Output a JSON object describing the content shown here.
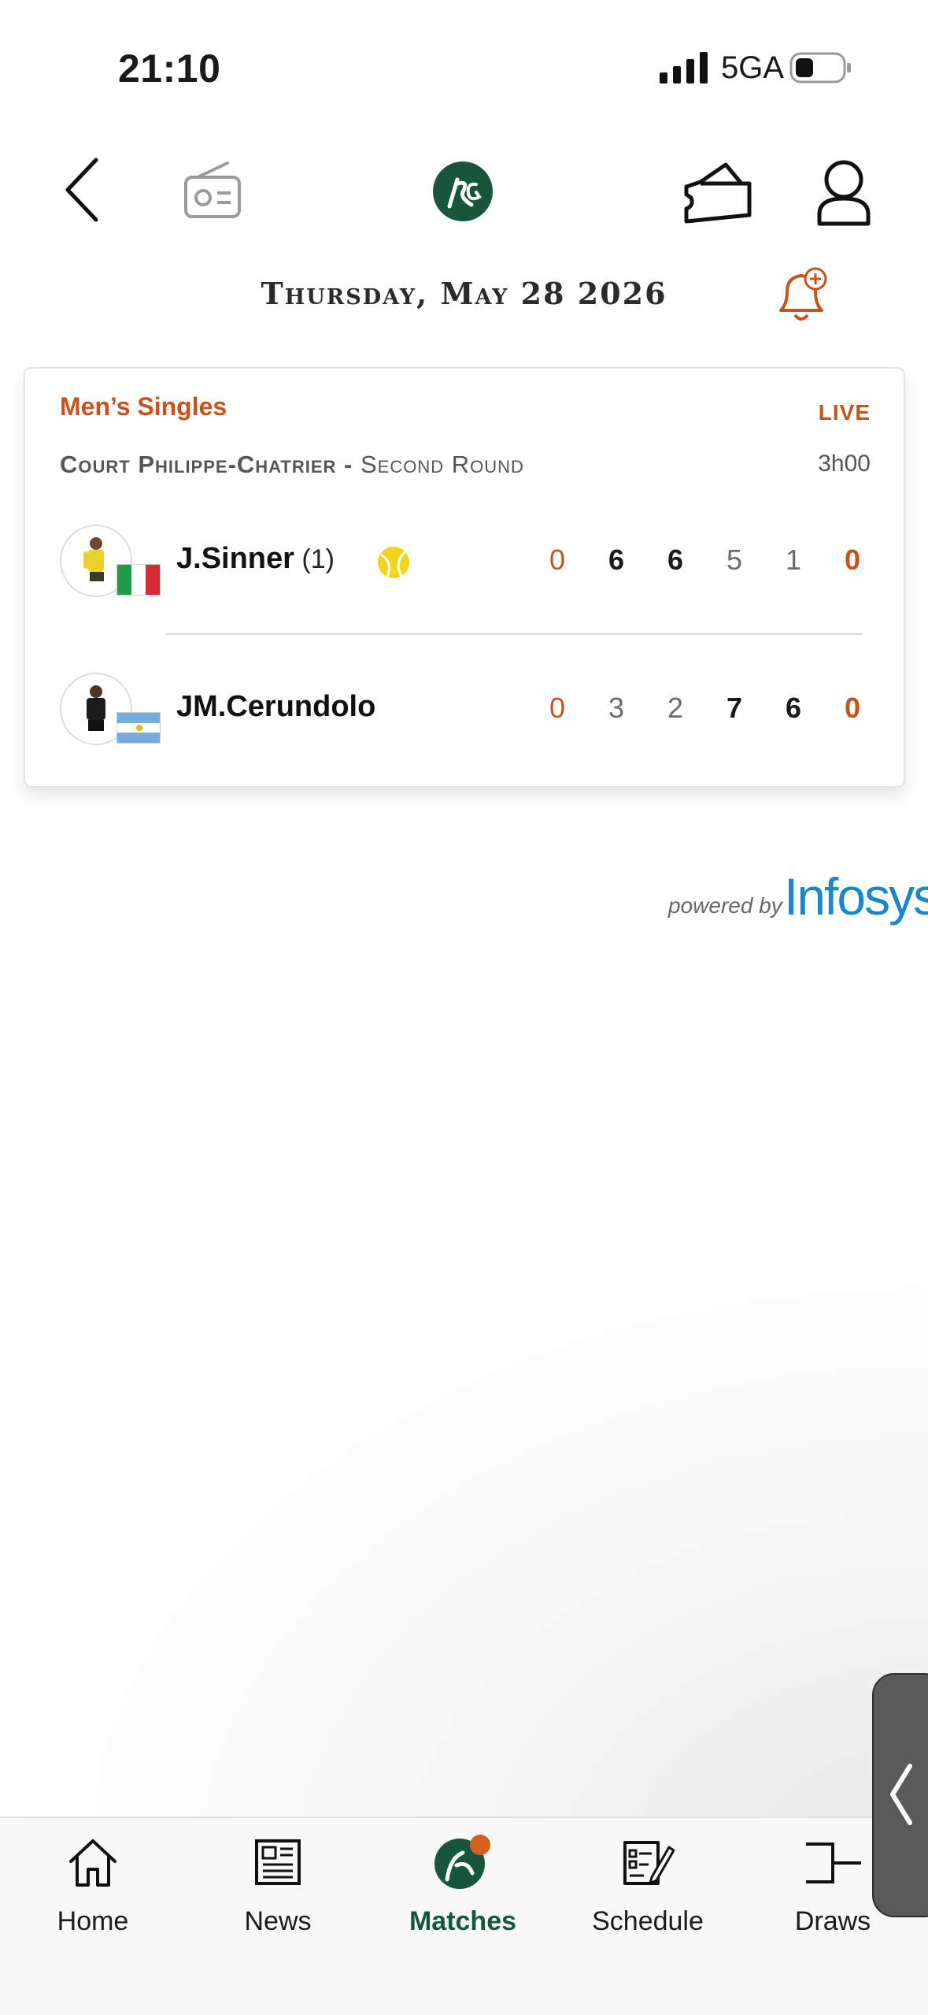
{
  "status_bar": {
    "time": "21:10",
    "network": "5GA"
  },
  "header": {
    "date": "Thursday, May 28 2026"
  },
  "match": {
    "event": "Men’s Singles",
    "status": "LIVE",
    "court": "Court Philippe-Chatrier",
    "separator": " - ",
    "round": "Second Round",
    "duration": "3h00",
    "players": [
      {
        "name": "J.Sinner",
        "seed": " (1)",
        "country": "Italy",
        "serving": true,
        "scores": [
          "0",
          "6",
          "6",
          "5",
          "1",
          "0"
        ]
      },
      {
        "name": "JM.Cerundolo",
        "seed": "",
        "country": "Argentina",
        "serving": false,
        "scores": [
          "0",
          "3",
          "2",
          "7",
          "6",
          "0"
        ]
      }
    ]
  },
  "powered_by": {
    "label": "powered by",
    "brand": "Infosys"
  },
  "tabs": [
    {
      "label": "Home",
      "icon": "home-icon"
    },
    {
      "label": "News",
      "icon": "news-icon"
    },
    {
      "label": "Matches",
      "icon": "matches-icon",
      "active": true
    },
    {
      "label": "Schedule",
      "icon": "schedule-icon"
    },
    {
      "label": "Draws",
      "icon": "draws-icon"
    }
  ],
  "colors": {
    "accent": "#c6531a",
    "brand_green": "#17563b",
    "infosys_blue": "#1b87c9"
  }
}
